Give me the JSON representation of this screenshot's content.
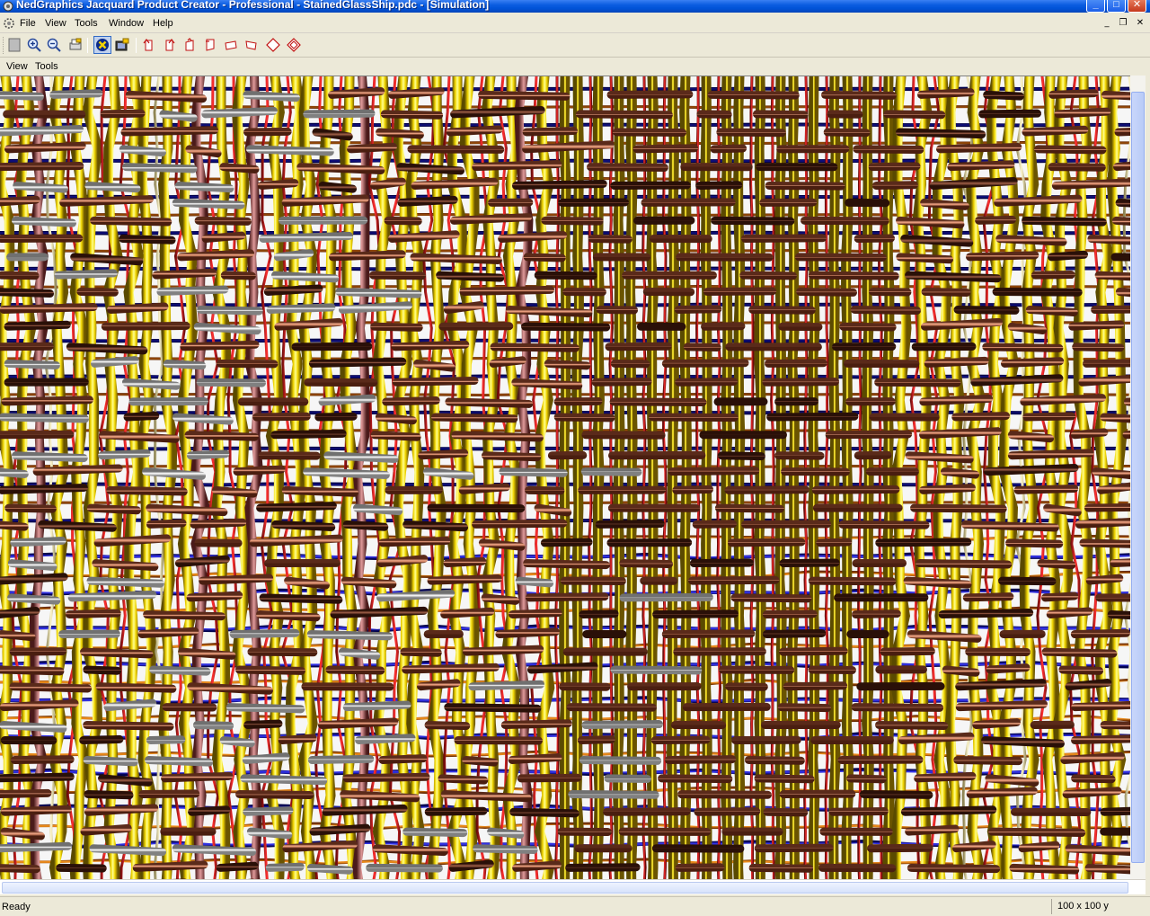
{
  "window": {
    "title": "NedGraphics Jacquard Product Creator - Professional - StainedGlassShip.pdc - [Simulation]",
    "minimize_glyph": "_",
    "maximize_glyph": "□",
    "close_glyph": "✕"
  },
  "menubar": {
    "items": [
      "File",
      "View",
      "Tools",
      "Window",
      "Help"
    ],
    "mdi_minimize": "_",
    "mdi_restore": "❐",
    "mdi_close": "✕"
  },
  "toolbar": {
    "buttons": [
      {
        "icon": "new-sheet-icon"
      },
      {
        "icon": "zoom-in-icon"
      },
      {
        "icon": "zoom-out-icon"
      },
      {
        "icon": "print-setup-icon"
      },
      {
        "icon": "simulation-mode-icon",
        "active": true
      },
      {
        "icon": "render-settings-icon"
      },
      {
        "icon": "rotate-left-icon"
      },
      {
        "icon": "rotate-right-icon"
      },
      {
        "icon": "tilt-up-icon"
      },
      {
        "icon": "tilt-down-icon"
      },
      {
        "icon": "bend-left-icon"
      },
      {
        "icon": "bend-right-icon"
      },
      {
        "icon": "view-front-icon"
      },
      {
        "icon": "view-reset-icon"
      }
    ]
  },
  "submenu": {
    "items": [
      "View",
      "Tools"
    ]
  },
  "simulation": {
    "content": "woven fabric 3D yarn simulation",
    "colors": {
      "yellow_warp": "#f0d400",
      "salmon_weft": "#d98b6a",
      "pink_weft": "#c87878",
      "white_weft": "#ffffff",
      "red_thread": "#d41c1c",
      "blue_thread": "#1c1ccc",
      "orange_thread": "#e8760a",
      "dark_brown": "#5a2a1c"
    }
  },
  "statusbar": {
    "status": "Ready",
    "size": "100 x  100 y"
  },
  "theme": {
    "titlebar": "#0a5ce0",
    "chrome": "#ece9d8"
  }
}
